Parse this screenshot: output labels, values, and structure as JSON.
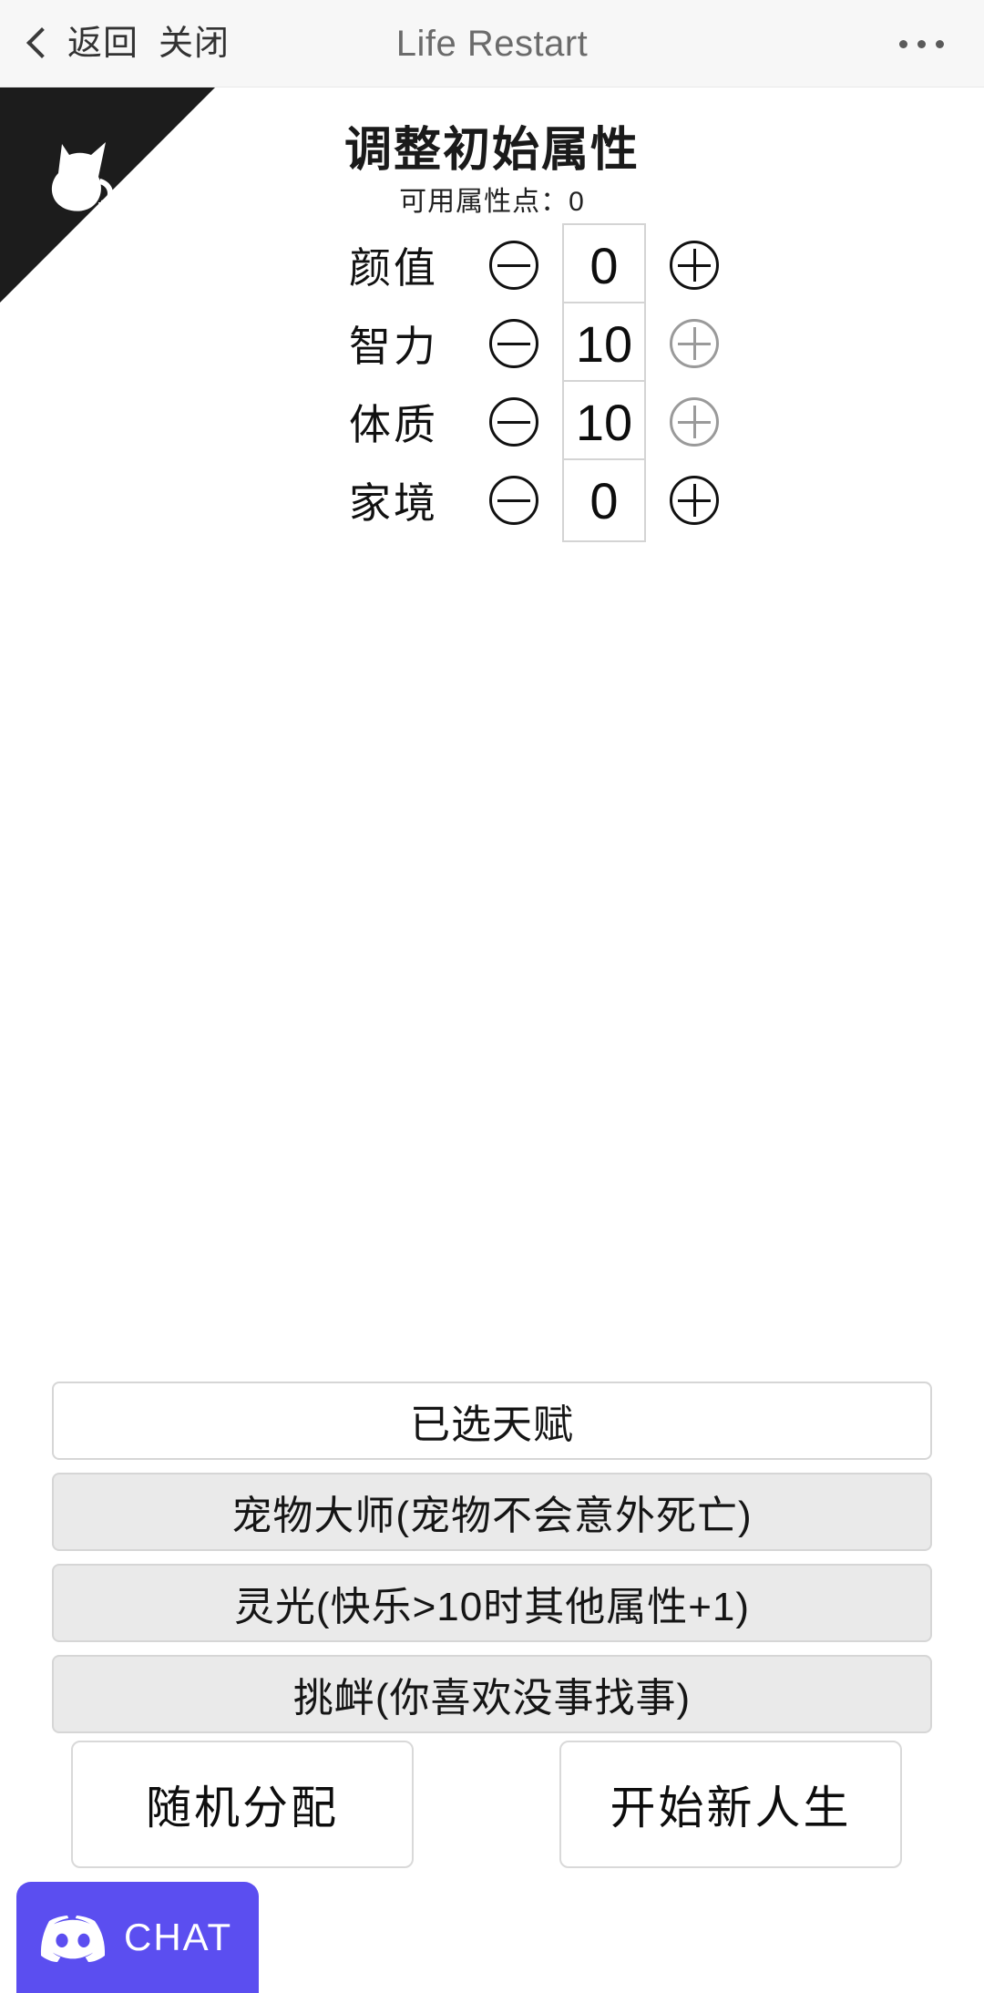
{
  "navbar": {
    "back_label": "返回",
    "close_label": "关闭",
    "title": "Life Restart",
    "more_icon": "ellipsis-icon"
  },
  "corner": {
    "icon": "cat-logo-icon"
  },
  "header": {
    "title": "调整初始属性",
    "subtitle": "可用属性点：0",
    "available_points": 0
  },
  "attributes": {
    "minus_icon": "minus-circle-icon",
    "plus_icon": "plus-circle-icon",
    "rows": [
      {
        "label": "颜值",
        "value": "0",
        "plus_enabled": true,
        "minus_enabled": true
      },
      {
        "label": "智力",
        "value": "10",
        "plus_enabled": false,
        "minus_enabled": true
      },
      {
        "label": "体质",
        "value": "10",
        "plus_enabled": false,
        "minus_enabled": true
      },
      {
        "label": "家境",
        "value": "0",
        "plus_enabled": true,
        "minus_enabled": true
      }
    ]
  },
  "talents": {
    "header_label": "已选天赋",
    "items": [
      {
        "label": "宠物大师(宠物不会意外死亡)"
      },
      {
        "label": "灵光(快乐>10时其他属性+1)"
      },
      {
        "label": "挑衅(你喜欢没事找事)"
      }
    ]
  },
  "actions": {
    "random_label": "随机分配",
    "start_label": "开始新人生"
  },
  "discord": {
    "label": "CHAT",
    "icon": "discord-icon",
    "color": "#5b4ef0"
  }
}
